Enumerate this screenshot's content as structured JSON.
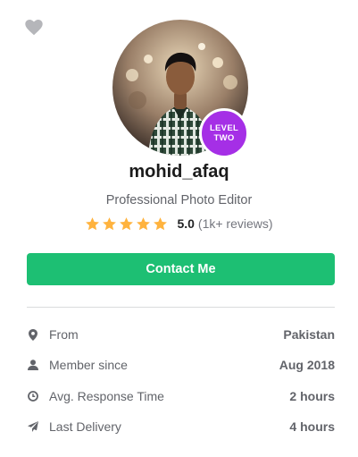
{
  "profile": {
    "username": "mohid_afaq",
    "tagline": "Professional Photo Editor",
    "level_line1": "LEVEL",
    "level_line2": "TWO",
    "rating": {
      "stars": 5,
      "score": "5.0",
      "reviews": "(1k+ reviews)"
    }
  },
  "actions": {
    "contact_label": "Contact Me"
  },
  "stats": [
    {
      "icon": "location-pin-icon",
      "label": "From",
      "value": "Pakistan"
    },
    {
      "icon": "user-icon",
      "label": "Member since",
      "value": "Aug 2018"
    },
    {
      "icon": "clock-icon",
      "label": "Avg. Response Time",
      "value": "2 hours"
    },
    {
      "icon": "paper-plane-icon",
      "label": "Last Delivery",
      "value": "4 hours"
    }
  ],
  "colors": {
    "accent_green": "#1dbf73",
    "level_badge": "#a52fe6",
    "star": "#ffb33e"
  }
}
